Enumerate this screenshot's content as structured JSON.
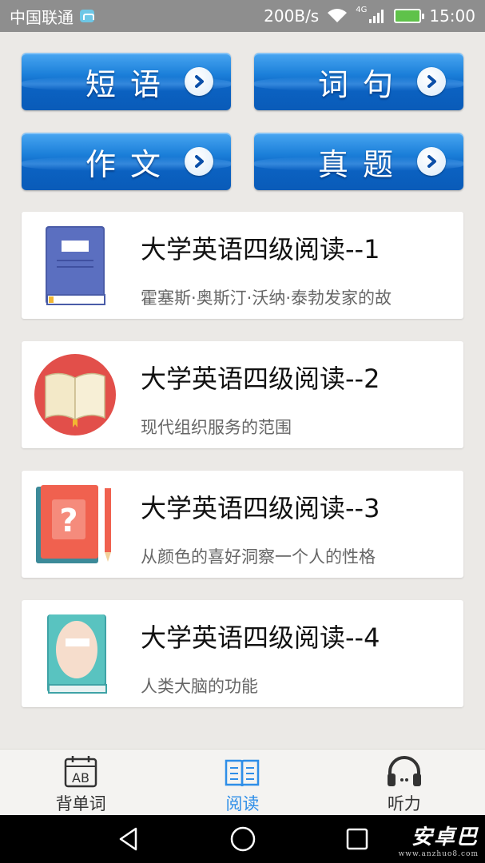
{
  "status_bar": {
    "carrier": "中国联通",
    "net_speed": "200B/s",
    "network_type": "4G",
    "time": "15:00"
  },
  "categories": [
    {
      "label": "短语",
      "icon": "chevron-right-icon"
    },
    {
      "label": "词句",
      "icon": "chevron-right-icon"
    },
    {
      "label": "作文",
      "icon": "chevron-right-icon"
    },
    {
      "label": "真题",
      "icon": "chevron-right-icon"
    }
  ],
  "articles": [
    {
      "title": "大学英语四级阅读--1",
      "summary": "霍塞斯·奥斯汀·沃纳·泰勃发家的故",
      "icon": "blue-book-icon"
    },
    {
      "title": "大学英语四级阅读--2",
      "summary": "现代组织服务的范围",
      "icon": "open-book-icon"
    },
    {
      "title": "大学英语四级阅读--3",
      "summary": "从颜色的喜好洞察一个人的性格",
      "icon": "question-book-icon"
    },
    {
      "title": "大学英语四级阅读--4",
      "summary": "人类大脑的功能",
      "icon": "teal-book-icon"
    }
  ],
  "tabs": [
    {
      "label": "背单词",
      "icon": "calendar-ab-icon",
      "active": false
    },
    {
      "label": "阅读",
      "icon": "book-icon",
      "active": true
    },
    {
      "label": "听力",
      "icon": "headphones-icon",
      "active": false
    }
  ],
  "watermark": {
    "main": "安卓巴",
    "sub": "www.anzhuo8.com"
  },
  "colors": {
    "accent": "#2e8ee8",
    "button_blue": "#0b62c2",
    "background": "#ebe9e6",
    "status_bar": "#8e8e8e"
  }
}
